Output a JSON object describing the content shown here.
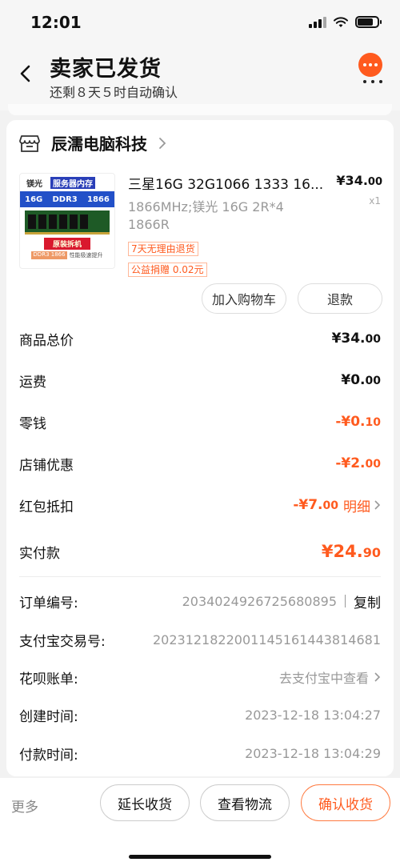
{
  "status_bar": {
    "time": "12:01"
  },
  "header": {
    "title": "卖家已发货",
    "subtitle": "还剩８天５时自动确认"
  },
  "shop": {
    "name": "辰濡电脑科技"
  },
  "product": {
    "image_text": {
      "brand": "镁光",
      "server": "服务器内存",
      "ddr": [
        "16G",
        "DDR3",
        "1866"
      ],
      "tag": "原装拆机",
      "bottom_badge": "DDR3 1866",
      "bottom_text": "性能极速提升"
    },
    "title": "三星16G 32G1066 1333 16...",
    "spec": "1866MHz;镁光 16G 2R*4 1866R",
    "price_main": "¥34.",
    "price_cents": "00",
    "qty": "x1",
    "tags": [
      "7天无理由退货",
      "公益捐赠 0.02元"
    ],
    "cart_button": "加入购物车",
    "refund_button": "退款"
  },
  "costs": [
    {
      "label": "商品总价",
      "main": "¥34.",
      "cents": "00",
      "highlight": false
    },
    {
      "label": "运费",
      "main": "¥0.",
      "cents": "00",
      "highlight": false
    },
    {
      "label": "零钱",
      "main": "-¥0.",
      "cents": "10",
      "highlight": true
    },
    {
      "label": "店铺优惠",
      "main": "-¥2.",
      "cents": "00",
      "highlight": true
    },
    {
      "label": "红包抵扣",
      "main": "-¥7.",
      "cents": "00",
      "highlight": true,
      "detail": "明细"
    }
  ],
  "paid": {
    "label": "实付款",
    "main": "¥24.",
    "cents": "90"
  },
  "info": {
    "order_no": {
      "label": "订单编号:",
      "value": "2034024926725680895",
      "copy": "复制"
    },
    "alipay_no": {
      "label": "支付宝交易号:",
      "value": "2023121822001145161443814681"
    },
    "huabei": {
      "label": "花呗账单:",
      "value": "去支付宝中查看"
    },
    "created": {
      "label": "创建时间:",
      "value": "2023-12-18 13:04:27"
    },
    "paid_time": {
      "label": "付款时间:",
      "value": "2023-12-18 13:04:29"
    }
  },
  "bottom": {
    "more": "更多",
    "extend": "延长收货",
    "logistics": "查看物流",
    "confirm": "确认收货"
  },
  "colors": {
    "accent": "#ff5a1e",
    "muted": "#999999"
  }
}
